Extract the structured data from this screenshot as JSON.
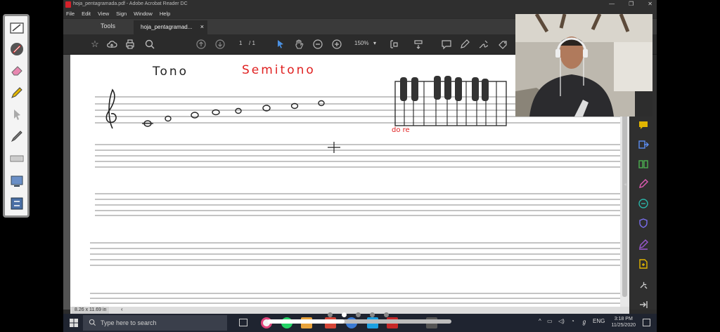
{
  "window": {
    "title": "hoja_pentagramada.pdf - Adobe Acrobat Reader DC",
    "controls": [
      "—",
      "❐",
      "✕"
    ]
  },
  "menu": [
    "File",
    "Edit",
    "View",
    "Sign",
    "Window",
    "Help"
  ],
  "tabs": {
    "tools": "Tools",
    "document": "hoja_pentagramad...",
    "close": "×"
  },
  "toolbar": {
    "page_current": "1",
    "page_total": "/ 1",
    "zoom": "150%"
  },
  "page": {
    "label_tono": "Tono",
    "label_semitono": "Semitono",
    "label_do_re": "do re",
    "crosshair": "+"
  },
  "status": {
    "page_size": "8.26 x 11.69 in"
  },
  "taskbar": {
    "search_placeholder": "Type here to search",
    "lang": "ENG",
    "time": "3:18 PM",
    "date": "11/25/2020"
  },
  "overlay": {
    "progress": 0.42,
    "slide_count": 5,
    "active_slide": 1
  },
  "colors": {
    "accent": "#d4212a",
    "annotation_red": "#e02020",
    "pen_yellow": "#e0b400",
    "panel_purple": "#9b59d0"
  }
}
